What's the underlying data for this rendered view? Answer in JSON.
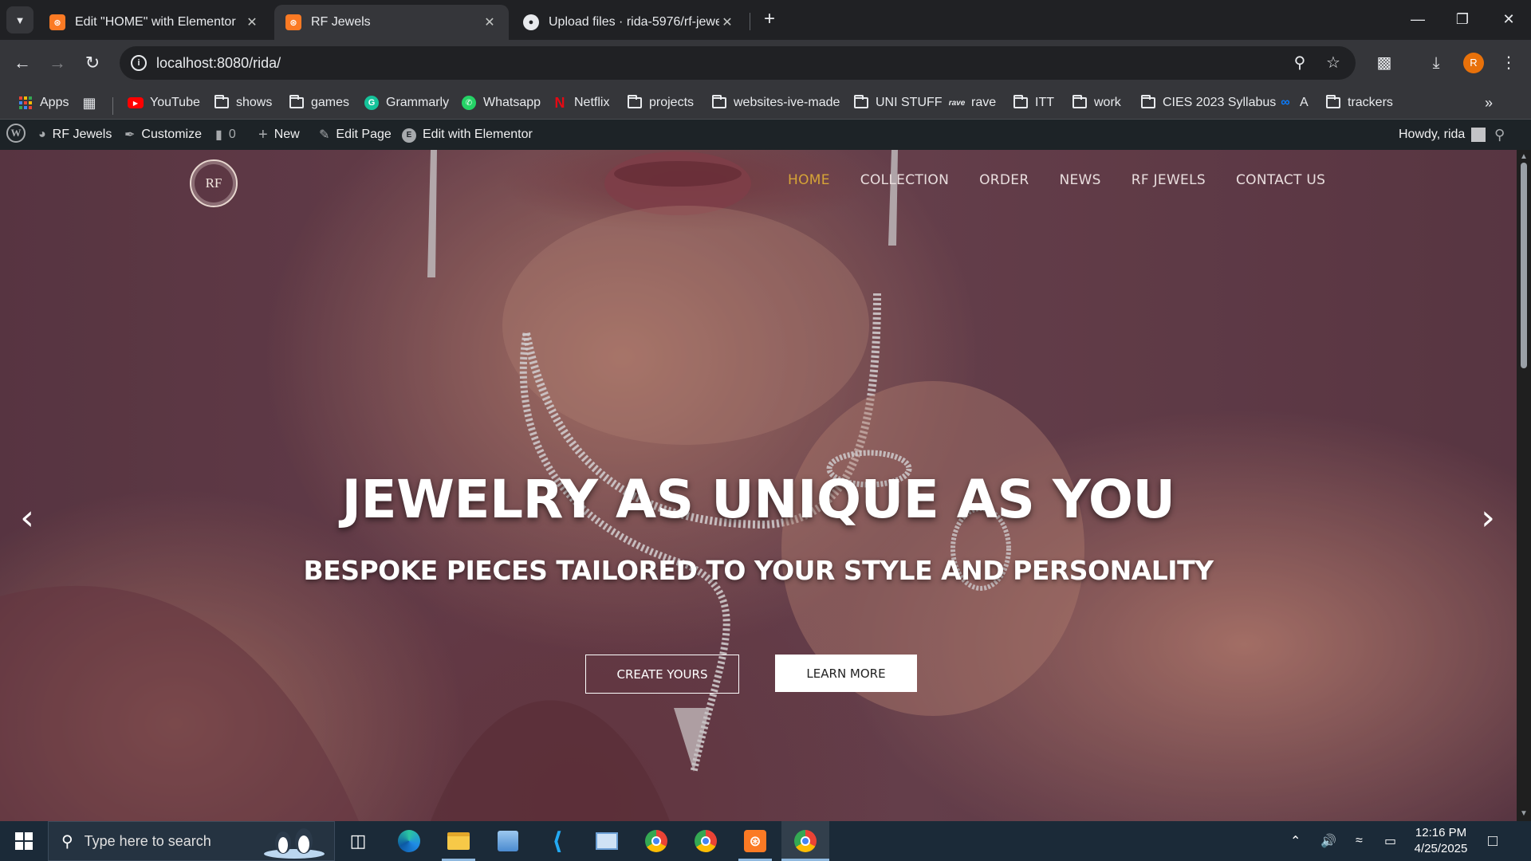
{
  "browser": {
    "tabs": [
      {
        "title": "Edit \"HOME\" with Elementor",
        "favicon": "xampp-icon",
        "active": false
      },
      {
        "title": "RF Jewels",
        "favicon": "xampp-icon",
        "active": true
      },
      {
        "title": "Upload files · rida-5976/rf-jewel",
        "favicon": "github-icon",
        "active": false
      }
    ],
    "url": "localhost:8080/rida/",
    "profile_initial": "R",
    "accent": "#e8710a"
  },
  "bookmarks": [
    {
      "label": "Apps",
      "icon": "apps-grid-icon"
    },
    {
      "label": "YouTube",
      "icon": "youtube-icon"
    },
    {
      "label": "shows",
      "icon": "folder-icon"
    },
    {
      "label": "games",
      "icon": "folder-icon"
    },
    {
      "label": "Grammarly",
      "icon": "grammarly-icon"
    },
    {
      "label": "Whatsapp",
      "icon": "whatsapp-icon"
    },
    {
      "label": "Netflix",
      "icon": "netflix-icon"
    },
    {
      "label": "projects",
      "icon": "folder-icon"
    },
    {
      "label": "websites-ive-made",
      "icon": "folder-icon"
    },
    {
      "label": "UNI STUFF",
      "icon": "folder-icon"
    },
    {
      "label": "rave",
      "icon": "rave-icon"
    },
    {
      "label": "ITT",
      "icon": "folder-icon"
    },
    {
      "label": "work",
      "icon": "folder-icon"
    },
    {
      "label": "CIES 2023 Syllabus",
      "icon": "folder-icon"
    },
    {
      "label": "A",
      "icon": "meta-icon"
    },
    {
      "label": "trackers",
      "icon": "folder-icon"
    }
  ],
  "wp_admin_bar": {
    "site_name": "RF Jewels",
    "customize": "Customize",
    "comments_count": "0",
    "new": "New",
    "edit_page": "Edit Page",
    "edit_elementor": "Edit with Elementor",
    "howdy": "Howdy, rida"
  },
  "site": {
    "logo_text": "RF",
    "nav": [
      "HOME",
      "COLLECTION",
      "ORDER",
      "NEWS",
      "RF JEWELS",
      "CONTACT US"
    ],
    "nav_active": "HOME",
    "nav_active_color": "#d6a437",
    "hero_title": "JEWELRY AS UNIQUE AS YOU",
    "hero_subtitle": "BESPOKE PIECES TAILORED TO YOUR STYLE AND PERSONALITY",
    "cta_primary": "CREATE YOURS",
    "cta_secondary": "LEARN MORE"
  },
  "taskbar": {
    "search_placeholder": "Type here to search",
    "time": "12:16 PM",
    "date": "4/25/2025"
  }
}
